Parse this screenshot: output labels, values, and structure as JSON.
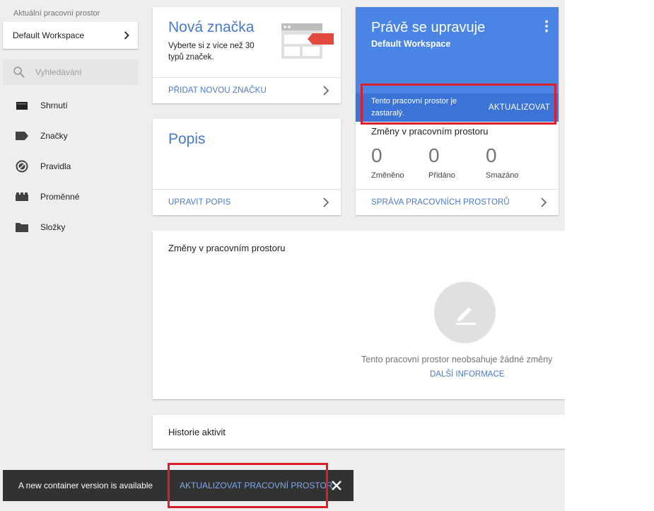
{
  "sidebar": {
    "workspace_caption": "Aktuální pracovní prostor",
    "workspace_name": "Default Workspace",
    "search_placeholder": "Vyhledávání",
    "items": [
      {
        "label": "Shrnutí",
        "icon": "summary-icon"
      },
      {
        "label": "Značky",
        "icon": "tag-icon"
      },
      {
        "label": "Pravidla",
        "icon": "trigger-icon"
      },
      {
        "label": "Proměnné",
        "icon": "variable-icon"
      },
      {
        "label": "Složky",
        "icon": "folder-icon"
      }
    ]
  },
  "cards": {
    "new_tag": {
      "title": "Nová značka",
      "description": "Vyberte si z více než 30 typů značek.",
      "link": "PŘIDAT NOVOU ZNAČKU"
    },
    "description": {
      "title": "Popis",
      "link": "UPRAVIT POPIS"
    },
    "editing": {
      "title": "Právě se upravuje",
      "workspace": "Default Workspace",
      "outdated_message": "Tento pracovní prostor je zastaralý.",
      "update_button": "AKTUALIZOVAT",
      "changes_title": "Změny v pracovním prostoru",
      "stats": [
        {
          "value": "0",
          "label": "Změněno"
        },
        {
          "value": "0",
          "label": "Přidáno"
        },
        {
          "value": "0",
          "label": "Smazáno"
        }
      ],
      "link": "SPRÁVA PRACOVNÍCH PROSTORŮ"
    },
    "changes": {
      "title": "Změny v pracovním prostoru",
      "empty_message": "Tento pracovní prostor neobsahuje žádné změny",
      "more_link": "DALŠÍ INFORMACE"
    },
    "history": {
      "title": "Historie aktivit"
    }
  },
  "snackbar": {
    "message": "A new container version is available",
    "action": "AKTUALIZOVAT PRACOVNÍ PROSTOR"
  },
  "colors": {
    "accent_blue": "#4a79c9",
    "header_blue": "#4a84e4",
    "outdated_blue": "#3b73d6",
    "highlight_red": "#d9202a",
    "snackbar_bg": "#323232"
  }
}
